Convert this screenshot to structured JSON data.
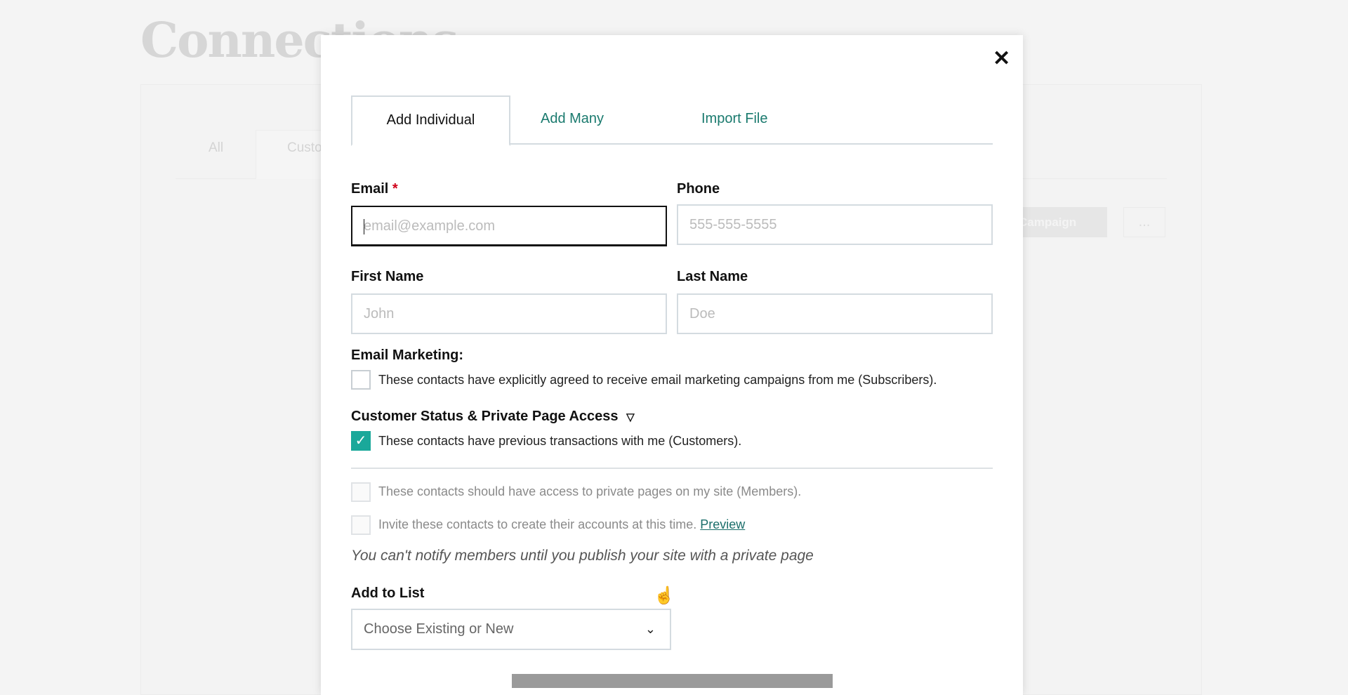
{
  "background": {
    "title": "Connections",
    "tabs": [
      "All",
      "Customers"
    ],
    "campaign_button": "Campaign",
    "more_button": "..."
  },
  "modal": {
    "close_icon": "close-icon",
    "tabs": [
      {
        "label": "Add Individual",
        "active": true
      },
      {
        "label": "Add Many"
      },
      {
        "label": "Import File"
      }
    ],
    "email": {
      "label": "Email",
      "required": "*",
      "placeholder": "email@example.com",
      "value": ""
    },
    "phone": {
      "label": "Phone",
      "placeholder": "555-555-5555",
      "value": ""
    },
    "first_name": {
      "label": "First Name",
      "placeholder": "John",
      "value": ""
    },
    "last_name": {
      "label": "Last Name",
      "placeholder": "Doe",
      "value": ""
    },
    "email_marketing": {
      "label": "Email Marketing:",
      "checkbox": "These contacts have explicitly agreed to receive email marketing campaigns from me (Subscribers).",
      "checked": false
    },
    "customer_status": {
      "label": "Customer Status & Private Page Access",
      "toggle_icon": "▽",
      "customers": "These contacts have previous transactions with me (Customers).",
      "customers_checked": true,
      "members": "These contacts should have access to private pages on my site (Members).",
      "members_checked": false,
      "invite": "Invite these contacts to create their accounts at this time.",
      "invite_checked": false,
      "preview_link": "Preview",
      "note": "You can't notify members until you publish your site with a private page"
    },
    "add_to_list": {
      "label": "Add to List",
      "placeholder": "Choose Existing or New"
    },
    "colors": {
      "accent": "#1aa89a",
      "link": "#1a7a6e",
      "required": "#d0021b"
    }
  }
}
